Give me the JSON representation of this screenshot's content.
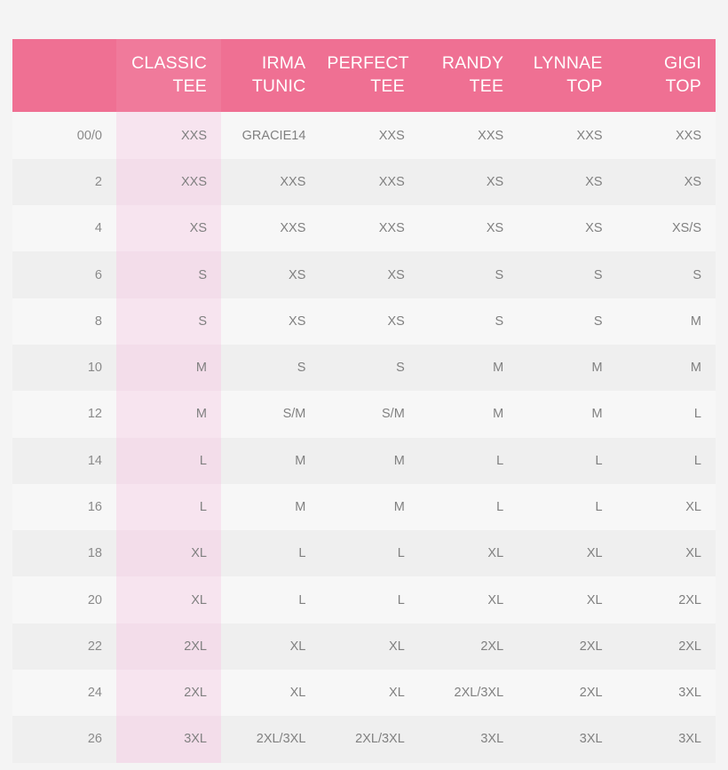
{
  "chart_data": {
    "type": "table",
    "title": "",
    "columns": [
      {
        "key": "size",
        "label": "",
        "highlight": false
      },
      {
        "key": "classic",
        "label": "CLASSIC TEE",
        "highlight": true
      },
      {
        "key": "irma",
        "label": "IRMA TUNIC",
        "highlight": false
      },
      {
        "key": "perfect",
        "label": "PERFECT TEE",
        "highlight": false
      },
      {
        "key": "randy",
        "label": "RANDY TEE",
        "highlight": false
      },
      {
        "key": "lynnae",
        "label": "LYNNAE TOP",
        "highlight": false
      },
      {
        "key": "gigi",
        "label": "GIGI TOP",
        "highlight": false
      }
    ],
    "header_lines": [
      [
        "",
        ""
      ],
      [
        "CLASSIC",
        "TEE"
      ],
      [
        "IRMA",
        "TUNIC"
      ],
      [
        "PERFECT",
        "TEE"
      ],
      [
        "RANDY",
        "TEE"
      ],
      [
        "LYNNAE",
        "TOP"
      ],
      [
        "GIGI",
        "TOP"
      ]
    ],
    "rows": [
      [
        "00/0",
        "XXS",
        "GRACIE14",
        "XXS",
        "XXS",
        "XXS",
        "XXS"
      ],
      [
        "2",
        "XXS",
        "XXS",
        "XXS",
        "XS",
        "XS",
        "XS"
      ],
      [
        "4",
        "XS",
        "XXS",
        "XXS",
        "XS",
        "XS",
        "XS/S"
      ],
      [
        "6",
        "S",
        "XS",
        "XS",
        "S",
        "S",
        "S"
      ],
      [
        "8",
        "S",
        "XS",
        "XS",
        "S",
        "S",
        "M"
      ],
      [
        "10",
        "M",
        "S",
        "S",
        "M",
        "M",
        "M"
      ],
      [
        "12",
        "M",
        "S/M",
        "S/M",
        "M",
        "M",
        "L"
      ],
      [
        "14",
        "L",
        "M",
        "M",
        "L",
        "L",
        "L"
      ],
      [
        "16",
        "L",
        "M",
        "M",
        "L",
        "L",
        "XL"
      ],
      [
        "18",
        "XL",
        "L",
        "L",
        "XL",
        "XL",
        "XL"
      ],
      [
        "20",
        "XL",
        "L",
        "L",
        "XL",
        "XL",
        "2XL"
      ],
      [
        "22",
        "2XL",
        "XL",
        "XL",
        "2XL",
        "2XL",
        "2XL"
      ],
      [
        "24",
        "2XL",
        "XL",
        "XL",
        "2XL/3XL",
        "2XL",
        "3XL"
      ],
      [
        "26",
        "3XL",
        "2XL/3XL",
        "2XL/3XL",
        "3XL",
        "3XL",
        "3XL"
      ]
    ],
    "colors": {
      "header_background": "#ef7093",
      "header_highlight_background": "#f07a9b",
      "header_text": "#ffffff",
      "row_light": "#f7f7f7",
      "row_dark": "#efefef",
      "highlight_light": "#f7e4ef",
      "highlight_dark": "#f3ddea",
      "body_text": "#808080",
      "page_background": "#f4f4f4"
    }
  }
}
